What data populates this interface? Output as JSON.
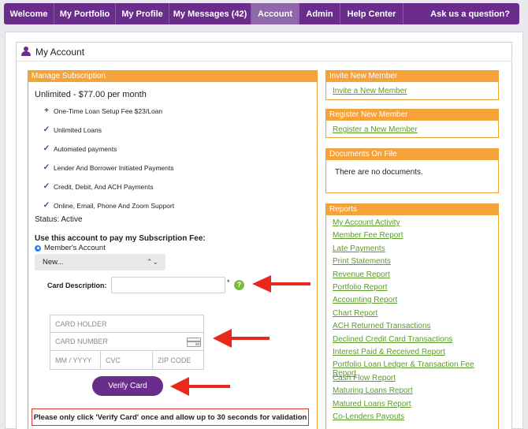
{
  "nav": {
    "items": [
      {
        "label": "Welcome",
        "active": false
      },
      {
        "label": "My Portfolio",
        "active": false
      },
      {
        "label": "My Profile",
        "active": false
      },
      {
        "label": "My Messages (42)",
        "active": false
      },
      {
        "label": "Account",
        "active": true
      },
      {
        "label": "Admin",
        "active": false
      },
      {
        "label": "Help Center",
        "active": false
      }
    ],
    "right_label": "Ask us a question?"
  },
  "account": {
    "title": "My Account"
  },
  "subscription": {
    "panel_title": "Manage Subscription",
    "plan": "Unlimited - $77.00 per month",
    "features": [
      {
        "mark": "+",
        "text": "One-Time Loan Setup Fee $23/Loan"
      },
      {
        "mark": "✓",
        "text": "Unlimited Loans"
      },
      {
        "mark": "✓",
        "text": "Automated payments"
      },
      {
        "mark": "✓",
        "text": "Lender And Borrower Initiated Payments"
      },
      {
        "mark": "✓",
        "text": "Credit, Debit, And ACH Payments"
      },
      {
        "mark": "✓",
        "text": "Online, Email, Phone And Zoom Support"
      }
    ],
    "status": "Status: Active",
    "pay_title": "Use this account to pay my Subscription Fee:",
    "radio_label": "Member's Account",
    "select_value": "New...",
    "card_description_label": "Card Description:",
    "card_description_value": "",
    "required_star": "*",
    "help_glyph": "?",
    "card_holder_placeholder": "CARD HOLDER",
    "card_number_placeholder": "CARD NUMBER",
    "expiry_placeholder": "MM / YYYY",
    "cvc_placeholder": "CVC",
    "zip_placeholder": "ZIP CODE",
    "verify_button": "Verify Card",
    "notice": "Please only click 'Verify Card' once and allow up to 30 seconds for validation"
  },
  "invite": {
    "panel_title": "Invite New Member",
    "link": "Invite a New Member"
  },
  "register": {
    "panel_title": "Register New Member",
    "link": "Register a New Member"
  },
  "documents": {
    "panel_title": "Documents On File",
    "text": "There are no documents."
  },
  "reports": {
    "panel_title": "Reports",
    "links": [
      "My Account Activity",
      "Member Fee Report",
      "Late Payments",
      "Print Statements",
      "Revenue Report",
      "Portfolio Report",
      "Accounting Report",
      "Chart Report",
      "ACH Returned Transactions",
      "Declined Credit Card Transactions",
      "Interest Paid & Received Report",
      "Portfolio Loan Ledger & Transaction Fee Report",
      "Cash Flow Report",
      "Maturing Loans Report",
      "Matured Loans Report",
      "Co-Lenders Payouts"
    ]
  },
  "colors": {
    "brand_purple": "#6b2d8b",
    "accent_orange": "#f5a23a",
    "link_green": "#5c9c2a",
    "arrow_red": "#e8291c"
  },
  "icons": [
    "user-icon",
    "check-icon",
    "plus-icon",
    "radio-selected-icon",
    "chevron-updown-icon",
    "help-icon",
    "credit-card-icon",
    "red-arrow-icon"
  ]
}
